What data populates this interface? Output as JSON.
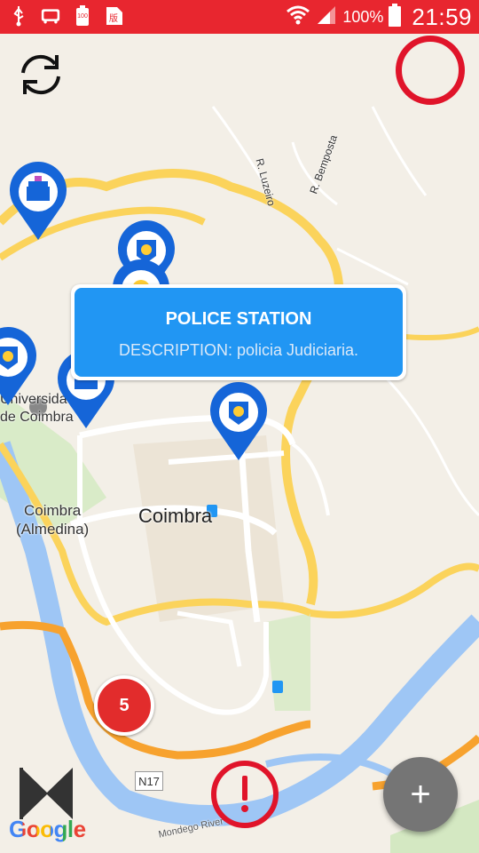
{
  "status_bar": {
    "icons": [
      "usb-icon",
      "sim-card-icon",
      "battery-saver-icon",
      "input-method-icon"
    ],
    "right_icons": [
      "wifi-icon",
      "signal-icon",
      "battery-icon"
    ],
    "battery": "100%",
    "time": "21:59"
  },
  "map": {
    "labels": {
      "street_1": "R. Luzeiro",
      "street_2": "R. Bemposta",
      "university": "Universidade\nde Coimbra",
      "city": "Coimbra",
      "district": "Coimbra\n(Almedina)",
      "river": "Mondego River",
      "road": "N17"
    }
  },
  "info_window": {
    "title": "POLICE STATION",
    "description": "DESCRIPTION: policia Judiciaria."
  },
  "cluster": {
    "count": "5"
  },
  "fab": {
    "label": "+"
  },
  "branding": {
    "google": "Google"
  },
  "colors": {
    "accent": "#e0142a",
    "marker": "#1565d8",
    "info_window": "#2196f3",
    "cluster": "#e22c2c",
    "fab": "#757575"
  }
}
